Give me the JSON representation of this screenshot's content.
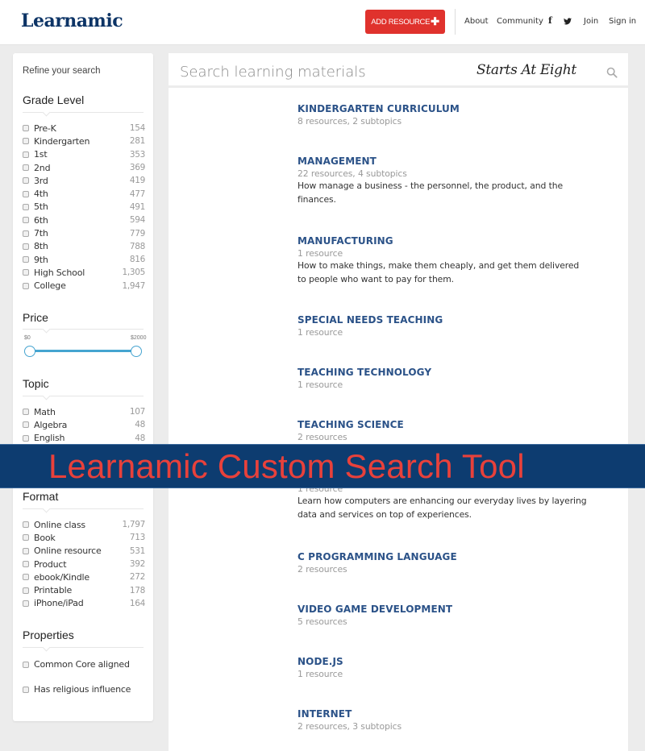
{
  "header": {
    "logo": "Learnamic",
    "add_resource_label": "ADD RESOURCE",
    "add_resource_icon": "plus-icon",
    "nav": {
      "about": "About",
      "community": "Community",
      "facebook_icon": "facebook-icon",
      "twitter_icon": "twitter-icon",
      "join": "Join",
      "sign_in": "Sign in"
    },
    "colors": {
      "brand": "#0d3466",
      "accent": "#e0322d"
    }
  },
  "sidebar": {
    "refine_label": "Refine your search",
    "grade_level": {
      "title": "Grade Level",
      "items": [
        {
          "label": "Pre-K",
          "count": "154"
        },
        {
          "label": "Kindergarten",
          "count": "281"
        },
        {
          "label": "1st",
          "count": "353"
        },
        {
          "label": "2nd",
          "count": "369"
        },
        {
          "label": "3rd",
          "count": "419"
        },
        {
          "label": "4th",
          "count": "477"
        },
        {
          "label": "5th",
          "count": "491"
        },
        {
          "label": "6th",
          "count": "594"
        },
        {
          "label": "7th",
          "count": "779"
        },
        {
          "label": "8th",
          "count": "788"
        },
        {
          "label": "9th",
          "count": "816"
        },
        {
          "label": "High School",
          "count": "1,305"
        },
        {
          "label": "College",
          "count": "1,947"
        }
      ]
    },
    "price": {
      "title": "Price",
      "min_label": "$0",
      "max_label": "$2000",
      "selected_min": 0,
      "selected_max": 2000
    },
    "topic": {
      "title": "Topic",
      "items": [
        {
          "label": "Math",
          "count": "107"
        },
        {
          "label": "Algebra",
          "count": "48"
        },
        {
          "label": "English",
          "count": "48"
        }
      ]
    },
    "format": {
      "title": "Format",
      "items": [
        {
          "label": "Online class",
          "count": "1,797"
        },
        {
          "label": "Book",
          "count": "713"
        },
        {
          "label": "Online resource",
          "count": "531"
        },
        {
          "label": "Product",
          "count": "392"
        },
        {
          "label": "ebook/Kindle",
          "count": "272"
        },
        {
          "label": "Printable",
          "count": "178"
        },
        {
          "label": "iPhone/iPad",
          "count": "164"
        }
      ]
    },
    "properties": {
      "title": "Properties",
      "items": [
        {
          "label": "Common Core aligned"
        },
        {
          "label": "Has religious influence"
        }
      ]
    }
  },
  "search": {
    "placeholder": "Search learning materials",
    "value": "",
    "watermark": "Starts At Eight"
  },
  "results": [
    {
      "title": "KINDERGARTEN CURRICULUM",
      "meta": "8 resources, 2 subtopics",
      "desc": ""
    },
    {
      "title": "MANAGEMENT",
      "meta": "22 resources, 4 subtopics",
      "desc": "How manage a business - the personnel, the product, and the finances."
    },
    {
      "title": "MANUFACTURING",
      "meta": "1 resource",
      "desc": "How to make things, make them cheaply, and get them delivered to people who want to pay for them."
    },
    {
      "title": "SPECIAL NEEDS TEACHING",
      "meta": "1 resource",
      "desc": ""
    },
    {
      "title": "TEACHING TECHNOLOGY",
      "meta": "1 resource",
      "desc": ""
    },
    {
      "title": "TEACHING SCIENCE",
      "meta": "2 resources",
      "desc": ""
    },
    {
      "title": "",
      "meta": "1 resource",
      "desc": "Learn how computers are enhancing our everyday lives by layering data and services on top of experiences."
    },
    {
      "title": "C PROGRAMMING LANGUAGE",
      "meta": "2 resources",
      "desc": ""
    },
    {
      "title": "VIDEO GAME DEVELOPMENT",
      "meta": "5 resources",
      "desc": ""
    },
    {
      "title": "NODE.JS",
      "meta": "1 resource",
      "desc": ""
    },
    {
      "title": "INTERNET",
      "meta": "2 resources, 3 subtopics",
      "desc": ""
    }
  ],
  "banner": {
    "text": "Learnamic Custom Search Tool",
    "background": "#0d3c70",
    "text_color": "#e8413b"
  }
}
